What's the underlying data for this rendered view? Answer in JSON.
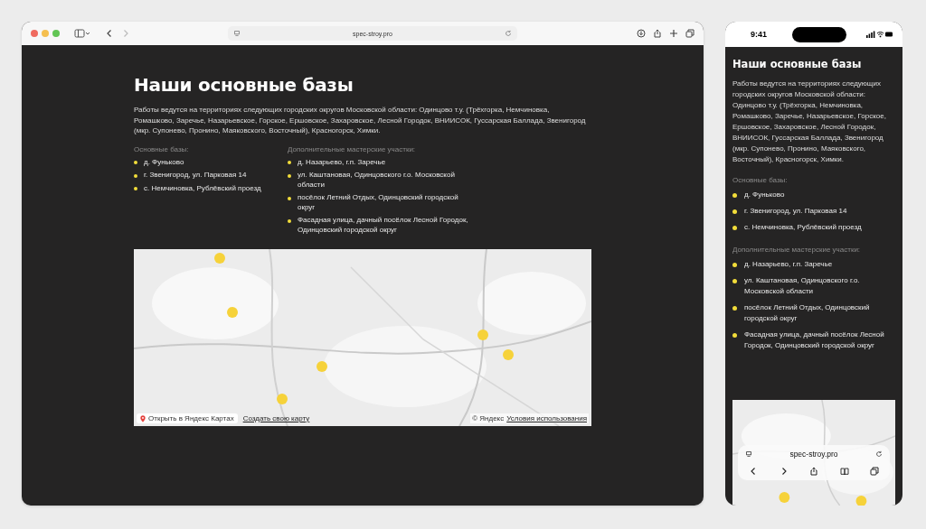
{
  "desktop": {
    "browser": {
      "url": "spec-stroy.pro"
    },
    "page": {
      "title": "Наши основные базы",
      "description": "Работы ведутся на территориях следующих городских округов Московской области: Одинцово т.у. (Трёхгорка, Немчиновка, Ромашково, Заречье, Назарьевское, Горское, Ершовское, Захаровское, Лесной Городок, ВНИИСОК, Гуссарская Баллада, Звенигород (мкр. Супонево, Пронино, Маяковского, Восточный), Красногорск, Химки.",
      "bases": {
        "heading": "Основные базы:",
        "items": [
          "д. Фуньково",
          "г. Звенигород, ул. Парковая 14",
          "с. Немчиновка, Рублёвский проезд"
        ]
      },
      "workshops": {
        "heading": "Дополнительные мастерские участки:",
        "items": [
          "д. Назарьево, г.п. Заречье",
          "ул. Каштановая, Одинцовского г.о. Московской области",
          "посёлок Летний Отдых, Одинцовский городской округ",
          "Фасадная улица, дачный посёлок Лесной Городок, Одинцовский городской округ"
        ]
      },
      "map": {
        "kind": "picture",
        "open_link": "Открыть в Яндекс Картах",
        "create_link": "Создать свою карту",
        "copyright": "© Яндекс",
        "terms_link": "Условия использования"
      }
    }
  },
  "phone": {
    "status_bar": {
      "time": "9:41"
    },
    "page": {
      "title": "Наши основные базы",
      "description": "Работы ведутся на территориях следующих городских округов Московской области: Одинцово т.у. (Трёхгорка, Немчиновка, Ромашково, Заречье, Назарьевское, Горское, Ершовское, Захаровское, Лесной Городок, ВНИИСОК, Гуссарская Баллада, Звенигород (мкр. Супонево, Пронино, Маяковского, Восточный), Красногорск, Химки.",
      "bases": {
        "heading": "Основные базы:",
        "items": [
          "д. Фуньково",
          "г. Звенигород, ул. Парковая 14",
          "с. Немчиновка, Рублёвский проезд"
        ]
      },
      "workshops": {
        "heading": "Дополнительные мастерские участки:",
        "items": [
          "д. Назарьево, г.п. Заречье",
          "ул. Каштановая, Одинцовского г.о. Московской области",
          "посёлок Летний Отдых, Одинцовский городской округ",
          "Фасадная улица, дачный посёлок Лесной Городок, Одинцовский городской округ"
        ]
      }
    },
    "browser_bar": {
      "url": "spec-stroy.pro"
    }
  }
}
